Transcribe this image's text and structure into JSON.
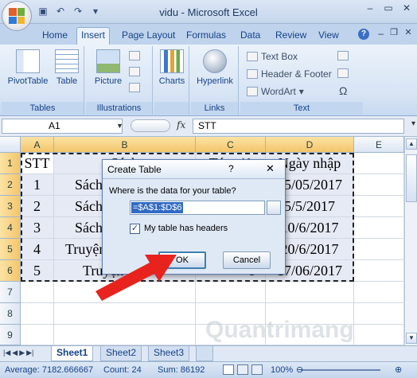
{
  "window": {
    "title": "vidu - Microsoft Excel"
  },
  "tabs": [
    "Home",
    "Insert",
    "Page Layout",
    "Formulas",
    "Data",
    "Review",
    "View"
  ],
  "active_tab": "Insert",
  "ribbon": {
    "groups": {
      "tables": {
        "label": "Tables",
        "pivot": "PivotTable",
        "table": "Table"
      },
      "illustrations": {
        "label": "Illustrations",
        "picture": "Picture"
      },
      "charts": {
        "label": "",
        "charts": "Charts"
      },
      "links": {
        "label": "Links",
        "hyperlink": "Hyperlink"
      },
      "text": {
        "label": "Text",
        "textbox": "Text Box",
        "header_footer": "Header & Footer",
        "wordart": "WordArt",
        "omega": "Ω"
      }
    }
  },
  "formula_bar": {
    "name_box": "A1",
    "fx": "fx",
    "content": "STT"
  },
  "columns": [
    "A",
    "B",
    "C",
    "D",
    "E"
  ],
  "rows": [
    "1",
    "2",
    "3",
    "4",
    "5",
    "6",
    "7",
    "8",
    "9"
  ],
  "cells": {
    "A1": "STT",
    "B1": "Sách",
    "C1": "Tác giả",
    "D1": "Ngày nhập",
    "A2": "1",
    "B2": "Sách",
    "D2": "15/05/2017",
    "A3": "2",
    "B3": "Sách",
    "D3": "5/5/2017",
    "A4": "3",
    "B4": "Sách",
    "D4": "10/6/2017",
    "A5": "4",
    "B5": "Truyện",
    "D5": "20/6/2017",
    "A6": "5",
    "B6": "Truyện",
    "C6": "ơ",
    "D6": "17/06/2017"
  },
  "dialog": {
    "title": "Create Table",
    "help": "?",
    "close": "✕",
    "prompt": "Where is the data for your table?",
    "range": "=$A$1:$D$6",
    "checkbox_label": "My table has headers",
    "checkbox_checked": "✓",
    "ok": "OK",
    "cancel": "Cancel"
  },
  "sheets": [
    "Sheet1",
    "Sheet2",
    "Sheet3"
  ],
  "active_sheet": "Sheet1",
  "status": {
    "average": "Average: 7182.666667",
    "count": "Count: 24",
    "sum": "Sum: 86192",
    "zoom": "100%"
  },
  "watermark": "Quantrimang",
  "colors": {
    "accent": "#15428b",
    "arrow": "#e8231e",
    "selection": "#316ac5"
  }
}
